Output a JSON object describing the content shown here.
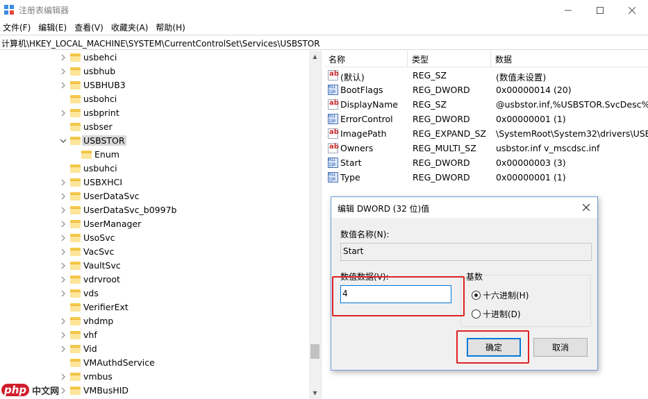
{
  "window": {
    "title": "注册表编辑器"
  },
  "menu": [
    "文件(F)",
    "编辑(E)",
    "查看(V)",
    "收藏夹(A)",
    "帮助(H)"
  ],
  "address": "计算机\\HKEY_LOCAL_MACHINE\\SYSTEM\\CurrentControlSet\\Services\\USBSTOR",
  "tree": {
    "items": [
      {
        "label": "usbehci",
        "expandable": true
      },
      {
        "label": "usbhub",
        "expandable": true
      },
      {
        "label": "USBHUB3",
        "expandable": true
      },
      {
        "label": "usbohci",
        "expandable": false
      },
      {
        "label": "usbprint",
        "expandable": true
      },
      {
        "label": "usbser",
        "expandable": false
      },
      {
        "label": "USBSTOR",
        "expandable": true,
        "expanded": true,
        "selected": true
      },
      {
        "label": "Enum",
        "expandable": false,
        "child": true
      },
      {
        "label": "usbuhci",
        "expandable": false
      },
      {
        "label": "USBXHCI",
        "expandable": true
      },
      {
        "label": "UserDataSvc",
        "expandable": true
      },
      {
        "label": "UserDataSvc_b0997b",
        "expandable": true
      },
      {
        "label": "UserManager",
        "expandable": true
      },
      {
        "label": "UsoSvc",
        "expandable": true
      },
      {
        "label": "VacSvc",
        "expandable": true
      },
      {
        "label": "VaultSvc",
        "expandable": true
      },
      {
        "label": "vdrvroot",
        "expandable": true
      },
      {
        "label": "vds",
        "expandable": true
      },
      {
        "label": "VerifierExt",
        "expandable": false
      },
      {
        "label": "vhdmp",
        "expandable": true
      },
      {
        "label": "vhf",
        "expandable": true
      },
      {
        "label": "Vid",
        "expandable": true
      },
      {
        "label": "VMAuthdService",
        "expandable": false
      },
      {
        "label": "vmbus",
        "expandable": true
      },
      {
        "label": "VMBusHID",
        "expandable": true
      }
    ]
  },
  "list": {
    "columns": [
      "名称",
      "类型",
      "数据"
    ],
    "rows": [
      {
        "icon": "string-value-icon",
        "name": "(默认)",
        "type": "REG_SZ",
        "data": "(数值未设置)"
      },
      {
        "icon": "binary-value-icon",
        "name": "BootFlags",
        "type": "REG_DWORD",
        "data": "0x00000014 (20)"
      },
      {
        "icon": "string-value-icon",
        "name": "DisplayName",
        "type": "REG_SZ",
        "data": "@usbstor.inf,%USBSTOR.SvcDesc%;US"
      },
      {
        "icon": "binary-value-icon",
        "name": "ErrorControl",
        "type": "REG_DWORD",
        "data": "0x00000001 (1)"
      },
      {
        "icon": "string-value-icon",
        "name": "ImagePath",
        "type": "REG_EXPAND_SZ",
        "data": "\\SystemRoot\\System32\\drivers\\USBST"
      },
      {
        "icon": "string-value-icon",
        "name": "Owners",
        "type": "REG_MULTI_SZ",
        "data": "usbstor.inf v_mscdsc.inf"
      },
      {
        "icon": "binary-value-icon",
        "name": "Start",
        "type": "REG_DWORD",
        "data": "0x00000003 (3)"
      },
      {
        "icon": "binary-value-icon",
        "name": "Type",
        "type": "REG_DWORD",
        "data": "0x00000001 (1)"
      }
    ]
  },
  "dialog": {
    "title": "编辑 DWORD (32 位)值",
    "name_label": "数值名称(N):",
    "name_value": "Start",
    "data_label": "数值数据(V):",
    "data_value": "4",
    "base_label": "基数",
    "radio_hex": "十六进制(H)",
    "radio_dec": "十进制(D)",
    "ok": "确定",
    "cancel": "取消"
  },
  "watermark": {
    "logo": "php",
    "text": "中文网"
  },
  "colors": {
    "highlight_red": "#e02020",
    "selection_gray": "#d9d9d9",
    "accent_blue": "#0078d7",
    "folder_yellow": "#f5c94a"
  }
}
